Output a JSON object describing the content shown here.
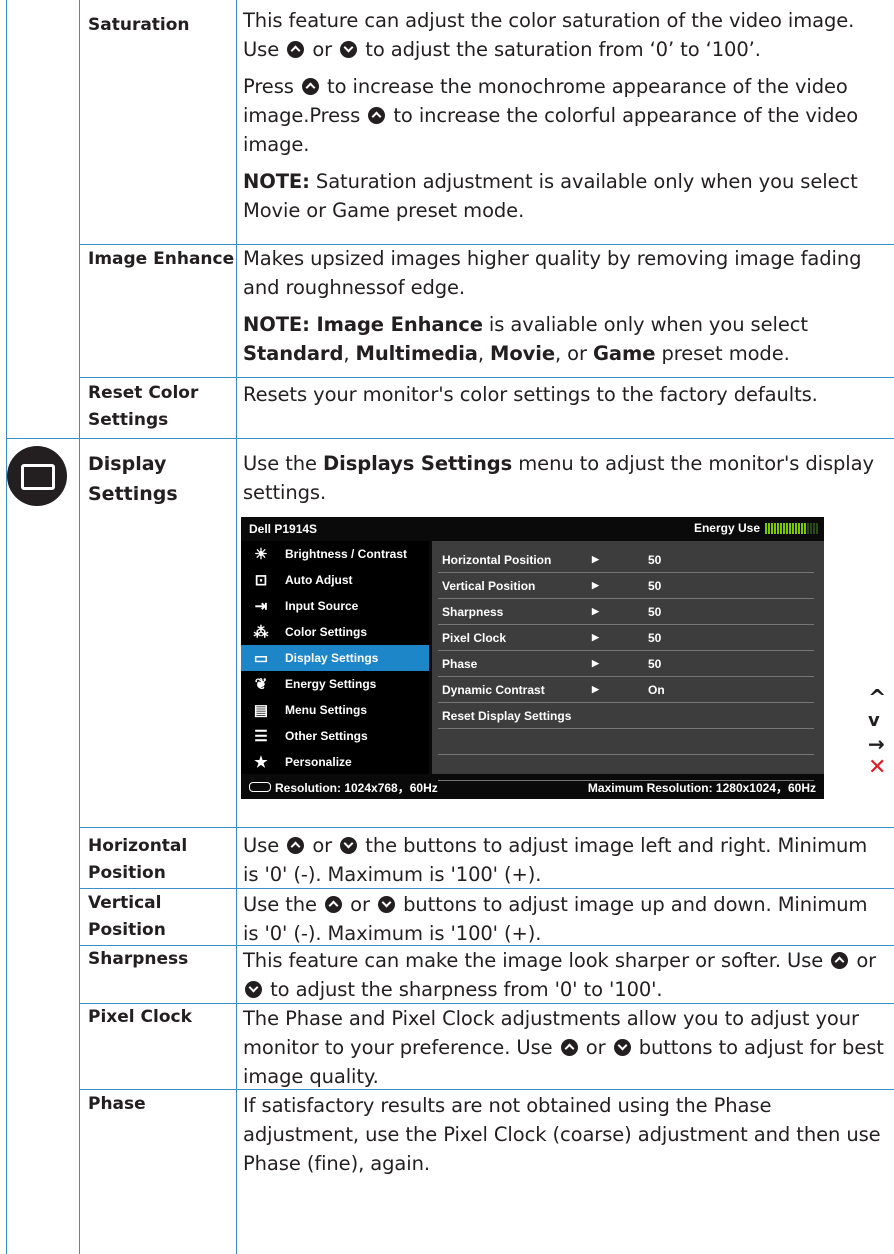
{
  "rows": {
    "saturation": {
      "label": "Saturation",
      "p1a": "This feature can adjust the color saturation of the video image. Use ",
      "p1b": " or ",
      "p1c": " to adjust the saturation from ‘0’ to ‘100’.",
      "p2a": "Press ",
      "p2b": " to increase the monochrome appearance of the video image.Press ",
      "p2c": " to increase the colorful appearance of the video image.",
      "note_label": "NOTE:",
      "note_text": " Saturation adjustment is available only when you select Movie or Game preset mode."
    },
    "image_enhance": {
      "label": "Image Enhance",
      "p1": "Makes upsized images higher quality by removing image fading and roughnessof edge.",
      "note_label": "NOTE: Image Enhance",
      "note_t1": " is avaliable only when you select ",
      "m1": "Standard",
      "c1": ", ",
      "m2": "Multimedia",
      "c2": ", ",
      "m3": "Movie",
      "c3": ", or ",
      "m4": "Game",
      "note_t2": " preset mode."
    },
    "reset_color": {
      "label": "Reset Color Settings",
      "text": "Resets your monitor's color settings to the factory defaults."
    },
    "display_settings": {
      "label": "Display Settings",
      "t1": "Use the ",
      "bold": "Displays Settings",
      "t2": " menu to adjust the monitor's display settings."
    },
    "horizontal": {
      "label": "Horizontal Position",
      "t1": "Use ",
      "t2": " or ",
      "t3": " the buttons to adjust image left and right. Minimum is '0' (-). Maximum is '100' (+)."
    },
    "vertical": {
      "label": "Vertical Position",
      "t1": " Use the ",
      "t2": " or ",
      "t3": " buttons to adjust image up and down. Minimum is '0' (-). Maximum is '100' (+)."
    },
    "sharpness": {
      "label": "Sharpness",
      "t1": "This feature can make the image look sharper or softer. Use ",
      "t2": " or ",
      "t3": " to adjust the sharpness from '0' to '100'."
    },
    "pixel_clock": {
      "label": "Pixel Clock",
      "t1": "The Phase and Pixel Clock adjustments allow you to adjust your monitor to your preference. Use ",
      "t2": " or ",
      "t3": " buttons to adjust for best image quality."
    },
    "phase": {
      "label": "Phase",
      "text": "If satisfactory results are not obtained using the Phase adjustment, use the Pixel Clock (coarse) adjustment and then use Phase (fine), again."
    }
  },
  "osd": {
    "title": "Dell P1914S",
    "energy_label": "Energy Use",
    "energy_level": 0.8,
    "menu": [
      {
        "label": "Brightness / Contrast",
        "icon": "brightness-icon"
      },
      {
        "label": "Auto Adjust",
        "icon": "auto-adjust-icon"
      },
      {
        "label": "Input Source",
        "icon": "input-source-icon"
      },
      {
        "label": "Color Settings",
        "icon": "color-settings-icon"
      },
      {
        "label": "Display Settings",
        "icon": "display-icon",
        "selected": true
      },
      {
        "label": "Energy Settings",
        "icon": "energy-icon"
      },
      {
        "label": "Menu Settings",
        "icon": "menu-icon"
      },
      {
        "label": "Other Settings",
        "icon": "other-settings-icon"
      },
      {
        "label": "Personalize",
        "icon": "star-icon"
      }
    ],
    "sub": [
      {
        "label": "Horizontal Position",
        "value": "50"
      },
      {
        "label": "Vertical Position",
        "value": "50"
      },
      {
        "label": "Sharpness",
        "value": "50"
      },
      {
        "label": "Pixel Clock",
        "value": "50"
      },
      {
        "label": "Phase",
        "value": "50"
      },
      {
        "label": "Dynamic Contrast",
        "value": "On"
      },
      {
        "label": "Reset Display Settings",
        "value": ""
      }
    ],
    "resolution": "Resolution: 1024x768，60Hz",
    "max_resolution": "Maximum Resolution: 1280x1024，60Hz"
  },
  "colors": {
    "rule": "#3a8fc4",
    "selected": "#1d86c9",
    "exit": "#e31b23",
    "energy": "#7ec800"
  }
}
